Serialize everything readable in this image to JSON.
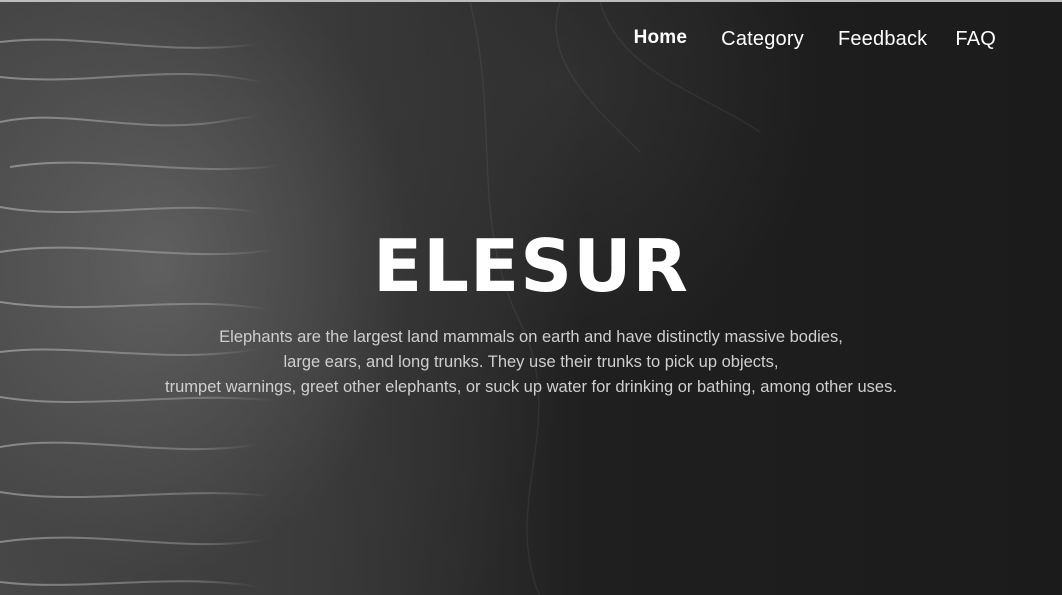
{
  "nav": {
    "items": [
      {
        "label": "Home",
        "active": true
      },
      {
        "label": "Category",
        "active": false
      },
      {
        "label": "Feedback",
        "active": false
      },
      {
        "label": "FAQ",
        "active": false
      }
    ]
  },
  "hero": {
    "title": "ELESUR",
    "description_lines": [
      "Elephants are the largest land mammals on earth and have distinctly massive bodies,",
      "large ears, and long trunks. They use their trunks to pick up objects,",
      "trumpet warnings, greet other elephants, or suck up water for drinking or bathing, among other uses."
    ],
    "background_image": "elephant-skin-photo"
  },
  "colors": {
    "text_primary": "#ffffff",
    "text_secondary": "#cfcfcf",
    "background_dark": "#1b1b1b"
  }
}
